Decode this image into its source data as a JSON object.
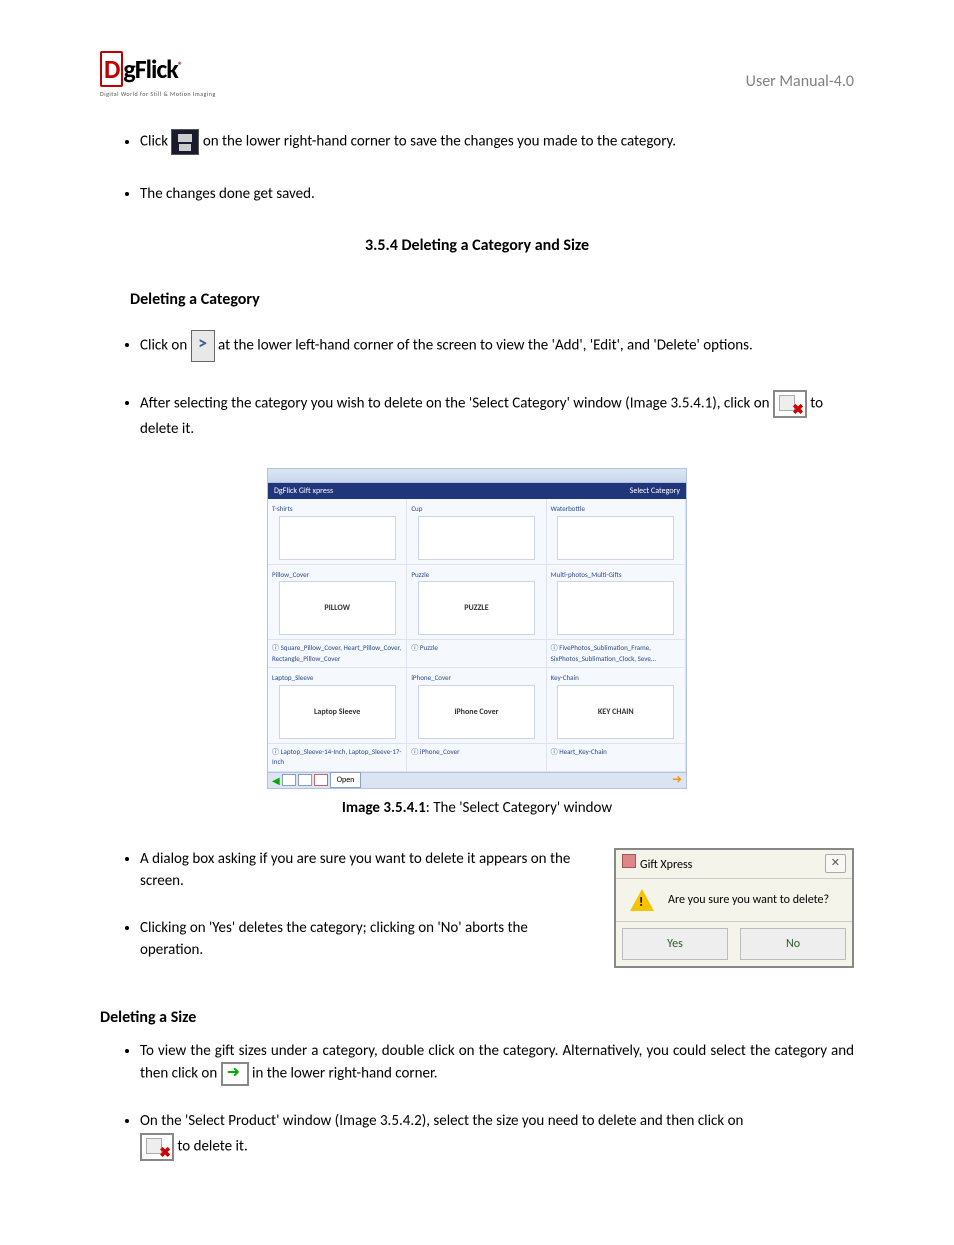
{
  "header": {
    "logo_brand": "DgFlick",
    "logo_tagline": "Digital World for Still & Motion Imaging",
    "manual_title": "User Manual-4.0"
  },
  "bullets_top": {
    "b1_pre": "Click ",
    "b1_post": " on the lower right-hand corner to save the changes you made to the category.",
    "b2": "The changes done get saved."
  },
  "section_heading": "3.5.4 Deleting a Category and Size",
  "delcat": {
    "heading": "Deleting a Category",
    "b1_pre": "Click on ",
    "b1_post": " at the lower left-hand corner of the screen to view the 'Add', 'Edit', and 'Delete' options.",
    "b2_pre": "After selecting the category you wish to delete on the 'Select Category' window (Image 3.5.4.1), click on ",
    "b2_post": " to delete it."
  },
  "figure1": {
    "brand_left": "DgFlick  Gift xpress",
    "brand_right": "Select Category",
    "cells": [
      {
        "label": "T-shirts",
        "thumb": ""
      },
      {
        "label": "Cup",
        "thumb": ""
      },
      {
        "label": "Waterbottle",
        "thumb": ""
      },
      {
        "label": "Pillow_Cover",
        "thumb": "PILLOW"
      },
      {
        "label": "Puzzle",
        "thumb": "PUZZLE"
      },
      {
        "label": "Multi-photos_Multi-Gifts",
        "thumb": ""
      },
      {
        "label": "Square_Pillow_Cover, Heart_Pillow_Cover, Rectangle_Pillow_Cover",
        "thumb": ""
      },
      {
        "label": "Puzzle",
        "thumb": ""
      },
      {
        "label": "FivePhotos_Sublimation_Frame, SixPhotos_Sublimation_Clock, Seve...",
        "thumb": ""
      },
      {
        "label": "Laptop_Sleeve",
        "thumb": "Laptop Sleeve"
      },
      {
        "label": "iPhone_Cover",
        "thumb": "iPhone Cover"
      },
      {
        "label": "Key-Chain",
        "thumb": "KEY CHAIN"
      },
      {
        "label": "Laptop_Sleeve-14-Inch, Laptop_Sleeve-17-Inch",
        "thumb": ""
      },
      {
        "label": "iPhone_Cover",
        "thumb": ""
      },
      {
        "label": "Heart_Key-Chain",
        "thumb": ""
      }
    ],
    "footer_open": "Open"
  },
  "caption1_bold": "Image 3.5.4.1",
  "caption1_rest": ": The 'Select Category' window",
  "dialog_section": {
    "b1": "A dialog box asking if you are sure you want to delete it appears on the screen.",
    "b2": "Clicking on 'Yes' deletes the category; clicking on 'No' aborts the operation."
  },
  "dialog": {
    "title": "Gift Xpress",
    "message": "Are you sure you want to delete?",
    "yes": "Yes",
    "no": "No",
    "close": "✕"
  },
  "delsize": {
    "heading": "Deleting a Size",
    "b1_pre": "To view the gift sizes under a category, double click on the category. Alternatively, you could select the category and then click on ",
    "b1_post": " in the lower right-hand corner.",
    "b2_pre": "On the 'Select Product' window (Image 3.5.4.2), select the size you need to delete and then click on ",
    "b2_post": " to delete it."
  }
}
